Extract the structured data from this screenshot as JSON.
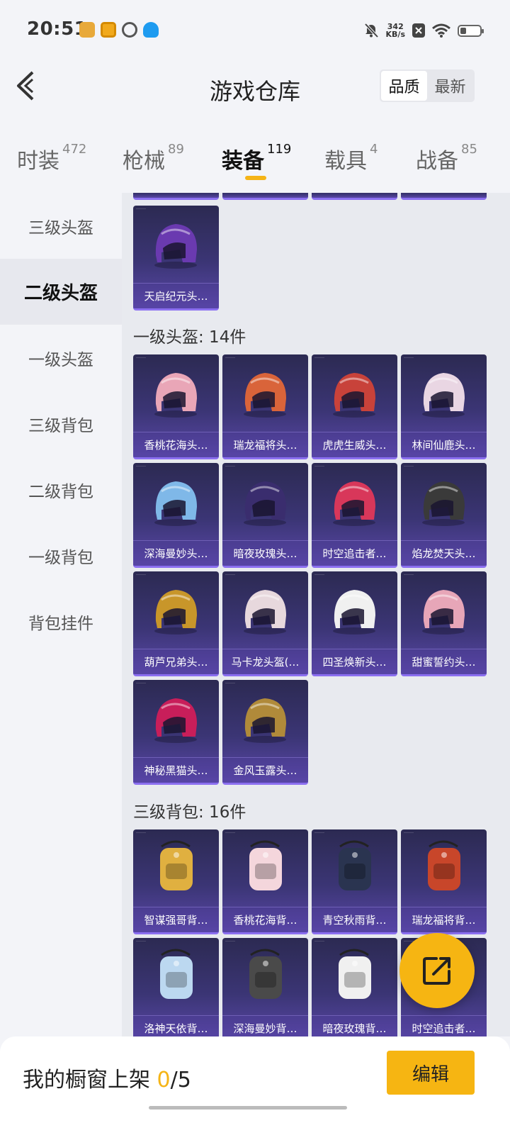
{
  "status": {
    "time": "20:51",
    "speed_value": "342",
    "speed_unit": "KB/s"
  },
  "header": {
    "title": "游戏仓库",
    "sort": [
      "品质",
      "最新"
    ]
  },
  "tabs": [
    {
      "label": "时装",
      "count": "472"
    },
    {
      "label": "枪械",
      "count": "89"
    },
    {
      "label": "装备",
      "count": "119"
    },
    {
      "label": "载具",
      "count": "4"
    },
    {
      "label": "战备",
      "count": "85"
    }
  ],
  "sidebar": [
    "三级头盔",
    "二级头盔",
    "一级头盔",
    "三级背包",
    "二级背包",
    "一级背包",
    "背包挂件"
  ],
  "sections": {
    "lvl2_helmets": [
      "天启纪元头…"
    ],
    "lvl1_label": "一级头盔: 14件",
    "lvl1_helmets": [
      "香桃花海头…",
      "瑞龙福将头…",
      "虎虎生威头…",
      "林间仙鹿头…",
      "深海曼妙头…",
      "暗夜玫瑰头…",
      "时空追击者…",
      "焰龙焚天头…",
      "葫芦兄弟头…",
      "马卡龙头盔(…",
      "四圣焕新头…",
      "甜蜜誓约头…",
      "神秘黑猫头…",
      "金风玉露头…"
    ],
    "lvl3_bag_label": "三级背包: 16件",
    "lvl3_bags": [
      "智谋强哥背…",
      "香桃花海背…",
      "青空秋雨背…",
      "瑞龙福将背…",
      "洛神天依背…",
      "深海曼妙背…",
      "暗夜玫瑰背…",
      "时空追击者…"
    ]
  },
  "bottom": {
    "showcase_label": "我的橱窗上架",
    "count": "0",
    "total": "/5",
    "edit_label": "编辑"
  },
  "colors": {
    "accent": "#f6b512",
    "card_top": "#2c2a52",
    "card_bottom": "#5a48a8"
  }
}
